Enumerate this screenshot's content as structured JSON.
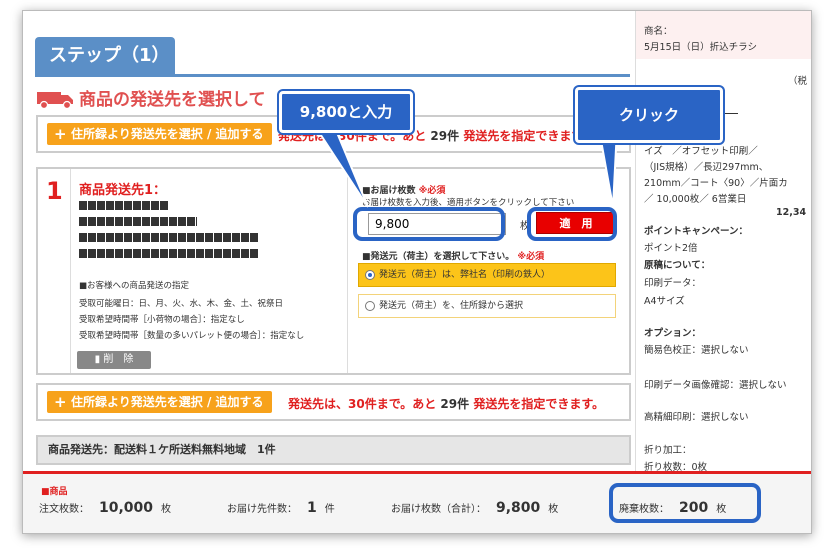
{
  "step": {
    "title": "ステップ（1）"
  },
  "section": {
    "title": "商品の発送先を選択して"
  },
  "top_bar": {
    "add_button": "住所録より発送先を選択 / 追加する",
    "info_prefix": "発送先は、30件まで。あと",
    "info_count": "29件",
    "info_suffix": "発送先を指定できます。"
  },
  "destination": {
    "number": "1",
    "title": "商品発送先1：",
    "note_head": "■お客様への商品発送の指定",
    "note_lines": [
      "受取可能曜日：日、月、火、水、木、金、土、祝祭日",
      "受取希望時間帯［小荷物の場合］：指定なし",
      "受取希望時間帯［数量の多いパレット便の場合］：指定なし"
    ],
    "delete_label": "削　除",
    "qty_label": "■お届け枚数",
    "qty_required": "※必須",
    "qty_desc": "お届け枚数を入力後、適用ボタンをクリックして下さい",
    "qty_value": "9,800",
    "qty_unit": "枚",
    "apply_label": "適　用",
    "ship_label": "■発送元（荷主）を選択して下さい。",
    "ship_required": "※必須",
    "ship_option1": "発送元（荷主）は、弊社名（印刷の鉄人）",
    "ship_option2": "発送元（荷主）を、住所録から選択"
  },
  "bottom_bar_add": {
    "add_button": "住所録より発送先を選択 / 追加する",
    "info_prefix": "発送先は、30件まで。あと",
    "info_count": "29件",
    "info_suffix": "発送先を指定できます。"
  },
  "summary": {
    "text": "商品発送先：配送料１ケ所送料無料地域　1件"
  },
  "right_panel": {
    "lines": [
      "商名：",
      "5月15日（日）折込チラシ",
      "（税",
      "イズ　／オフセット印刷／",
      "（JIS規格）／長辺297mm、",
      "210mm／コート〈90〉／片面カ",
      "／ 10,000枚／ 6営業日",
      "12,34",
      "ポイントキャンペーン：",
      "ポイント2倍",
      "原稿について：",
      "印刷データ：",
      "A4サイズ",
      "オプション：",
      "簡易色校正：選択しない",
      "印刷データ画像確認：選択しない",
      "高精細印刷：選択しない",
      "折り加工：",
      "折り枚数：0枚"
    ]
  },
  "totals": {
    "label": "■商品",
    "order_label": "注文枚数：",
    "order_value": "10,000",
    "delivery_count_label": "お届け先件数：",
    "delivery_count_value": "1",
    "delivery_count_unit": "件",
    "delivery_total_label": "お届け枚数（合計）：",
    "delivery_total_value": "9,800",
    "waste_label": "廃棄枚数：",
    "waste_value": "200",
    "unit": "枚"
  },
  "callouts": {
    "input": "9,800と入力",
    "click": "クリック"
  },
  "colors": {
    "accent_blue": "#2a64c5",
    "step_blue": "#5b8fc7",
    "red": "#e02020",
    "orange": "#f7a21b"
  }
}
